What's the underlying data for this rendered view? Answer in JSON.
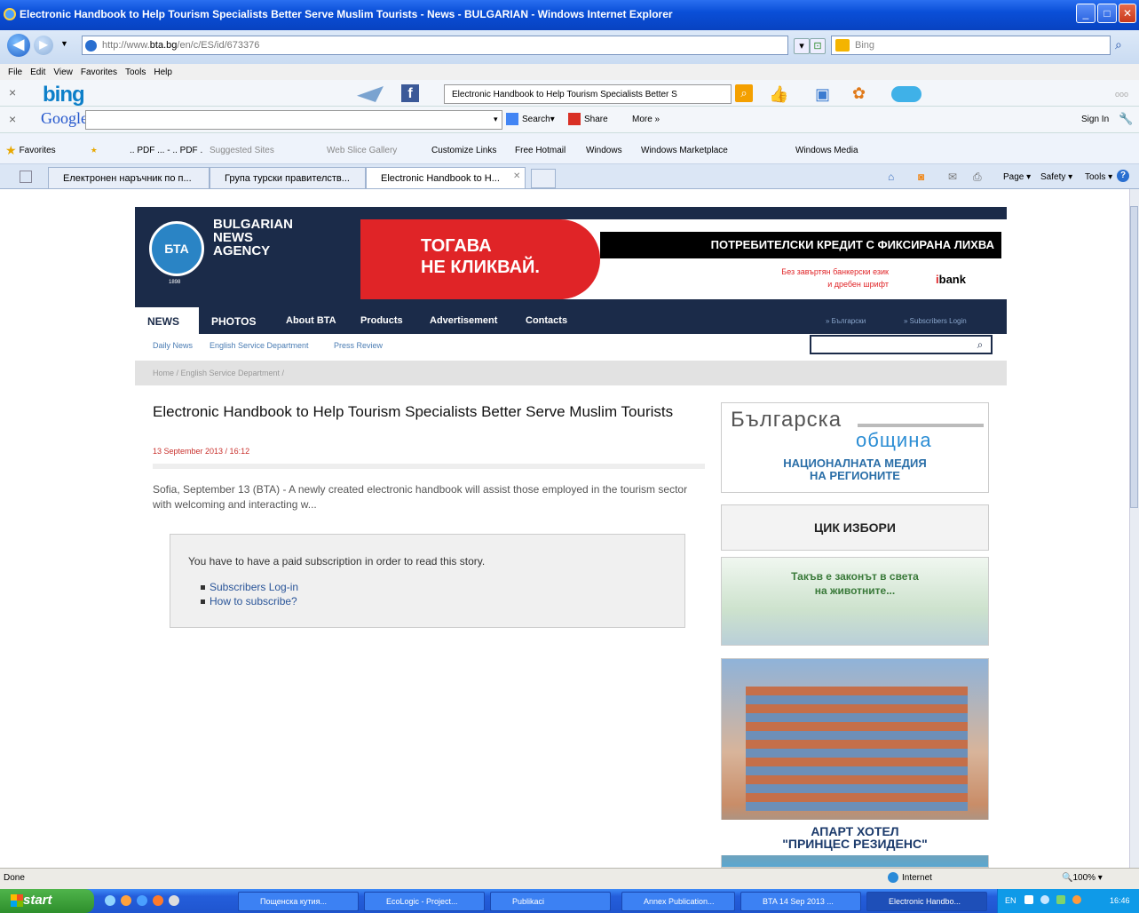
{
  "window": {
    "title": "Electronic Handbook to Help Tourism Specialists Better Serve Muslim Tourists - News - BULGARIAN - Windows Internet Explorer"
  },
  "address": {
    "prefix": "http://www.",
    "domain": "bta.bg",
    "path": "/en/c/ES/id/673376"
  },
  "search": {
    "placeholder": "Bing"
  },
  "menu": [
    "File",
    "Edit",
    "View",
    "Favorites",
    "Tools",
    "Help"
  ],
  "bingbar": {
    "logo": "bing",
    "query": "Electronic Handbook to Help Tourism Specialists Better S"
  },
  "googlebar": {
    "logo": "Google",
    "search": "Search",
    "share": "Share",
    "more": "More »",
    "signin": "Sign In"
  },
  "favorites": {
    "label": "Favorites",
    "items": [
      ".. PDF ... - .. PDF .",
      "Suggested Sites",
      "Web Slice Gallery",
      "Customize Links",
      "Free Hotmail",
      "Windows",
      "Windows Marketplace",
      "Windows Media"
    ]
  },
  "tabs": [
    "Електронен наръчник по п...",
    "Група турски правителств...",
    "Electronic Handbook to H..."
  ],
  "commandbar": {
    "page": "Page",
    "safety": "Safety",
    "tools": "Tools"
  },
  "site": {
    "logo_text": "БТА",
    "name_lines": [
      "BULGARIAN",
      "NEWS",
      "AGENCY"
    ],
    "year": "1898",
    "banner": {
      "red_line1": "ТОГАВА",
      "red_line2": "НЕ КЛИКВАЙ.",
      "black": "ПОТРЕБИТЕЛСКИ КРЕДИТ С ФИКСИРАНА ЛИХВА",
      "sub1": "Без завъртян банкерски език",
      "sub2": "и дребен шрифт",
      "brand_i": "i",
      "brand": "bank"
    },
    "nav": [
      "NEWS",
      "PHOTOS",
      "About BTA",
      "Products",
      "Advertisement",
      "Contacts"
    ],
    "nav_right": [
      "» Български",
      "» Subscribers Login"
    ],
    "subnav": [
      "Daily News",
      "English Service Department",
      "Press Review"
    ],
    "breadcrumb": "Home / English Service Department /"
  },
  "article": {
    "title": "Electronic Handbook to Help Tourism Specialists Better Serve Muslim Tourists",
    "date": "13 September 2013 / 16:12",
    "lede": "Sofia, September 13 (BTA) - A newly created electronic handbook will assist those employed in the tourism sector with welcoming and interacting w...",
    "paywall": "You have to have a paid subscription in order to read this story.",
    "links": [
      "Subscribers Log-in",
      "How to subscribe?"
    ]
  },
  "sidebar": {
    "ad1_line1": "Българска",
    "ad1_line2": "община",
    "ad1_line3": "НАЦИОНАЛНАТА МЕДИЯ",
    "ad1_line4": "НА РЕГИОНИТЕ",
    "ad2": "ЦИК ИЗБОРИ",
    "ad3_line1": "Такъв е законът в света",
    "ad3_line2": "на животните...",
    "ad4_line1": "АПАРТ ХОТЕЛ",
    "ad4_line2": "\"ПРИНЦЕС РЕЗИДЕНС\""
  },
  "status": {
    "left": "Done",
    "zone": "Internet",
    "zoom": "100%"
  },
  "taskbar": {
    "start": "start",
    "tasks": [
      "Пощенска кутия...",
      "EcoLogic - Project...",
      "Publikaci",
      "Annex Publication...",
      "BTA 14 Sep 2013 ...",
      "Electronic Handbo..."
    ],
    "lang": "EN",
    "clock": "16:46"
  },
  "colors": {
    "bta_navy": "#1b2b49",
    "banner_red": "#e02427",
    "link_blue": "#2a5599",
    "date_red": "#c9302c"
  }
}
